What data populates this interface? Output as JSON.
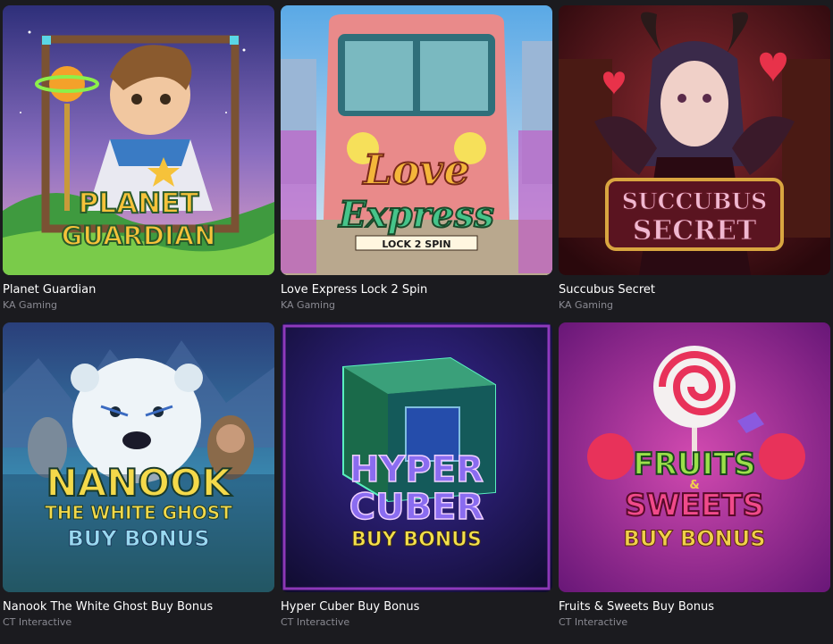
{
  "games": [
    {
      "title": "Planet Guardian",
      "provider": "KA Gaming",
      "logo": [
        "PLANET",
        "GUARDIAN"
      ],
      "colors": {
        "bg_top": "#3b3f8f",
        "bg_bottom": "#c98dc9",
        "logo": "#f6c23a",
        "logo_stroke": "#2a5a2a"
      }
    },
    {
      "title": "Love Express Lock 2 Spin",
      "provider": "KA Gaming",
      "logo": [
        "Love",
        "Express",
        "LOCK 2 SPIN"
      ],
      "colors": {
        "bg_top": "#6fb5e8",
        "bg_bottom": "#c9d9e9",
        "logo": "#f4b63a",
        "logo2": "#46c48a"
      }
    },
    {
      "title": "Succubus Secret",
      "provider": "KA Gaming",
      "logo": [
        "SUCCUBUS",
        "SECRET"
      ],
      "colors": {
        "bg_top": "#3a0d12",
        "bg_bottom": "#6b1a1e",
        "logo": "#f0b8d0",
        "logo_stroke": "#d9a640"
      }
    },
    {
      "title": "Nanook The White Ghost Buy Bonus",
      "provider": "CT Interactive",
      "logo": [
        "NANOOK",
        "THE WHITE GHOST",
        "BUY BONUS"
      ],
      "colors": {
        "bg_top": "#1f3b6e",
        "bg_bottom": "#4aa3a8",
        "logo": "#f4d94a",
        "logo2": "#9ad8f0"
      }
    },
    {
      "title": "Hyper Cuber Buy Bonus",
      "provider": "CT Interactive",
      "logo": [
        "HYPER",
        "CUBER",
        "BUY BONUS"
      ],
      "colors": {
        "bg_top": "#140c3a",
        "bg_bottom": "#2b1a6a",
        "logo": "#8a6cf0",
        "logo2": "#f4e04a"
      }
    },
    {
      "title": "Fruits & Sweets Buy Bonus",
      "provider": "CT Interactive",
      "logo": [
        "FRUITS",
        "&",
        "SWEETS",
        "BUY BONUS"
      ],
      "colors": {
        "bg_top": "#7a1a8a",
        "bg_bottom": "#c73aa0",
        "logo": "#9be04a",
        "logo2": "#f0d04a"
      }
    }
  ]
}
